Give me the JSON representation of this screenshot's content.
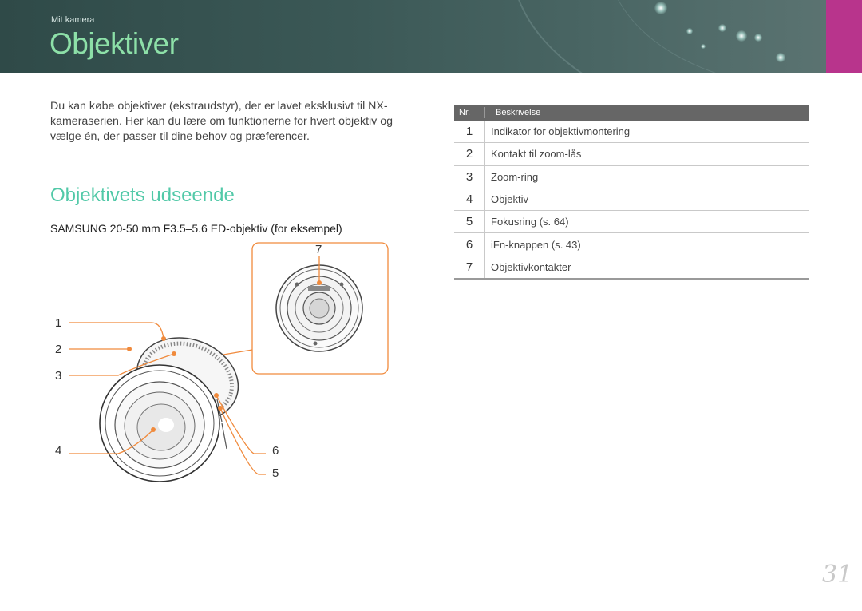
{
  "header": {
    "breadcrumb": "Mit kamera",
    "title": "Objektiver"
  },
  "intro": "Du kan købe objektiver (ekstraudstyr), der er lavet eksklusivt til NX-kameraserien. Her kan du lære om funktionerne for hvert objektiv og vælge én, der passer til dine behov og præferencer.",
  "section_title": "Objektivets udseende",
  "lens_caption": "SAMSUNG 20-50 mm F3.5–5.6 ED-objektiv (for eksempel)",
  "callouts": {
    "n1": "1",
    "n2": "2",
    "n3": "3",
    "n4": "4",
    "n5": "5",
    "n6": "6",
    "n7": "7"
  },
  "table": {
    "col_nr": "Nr.",
    "col_desc": "Beskrivelse",
    "rows": [
      {
        "nr": "1",
        "desc": "Indikator for objektivmontering"
      },
      {
        "nr": "2",
        "desc": "Kontakt til zoom-lås"
      },
      {
        "nr": "3",
        "desc": "Zoom-ring"
      },
      {
        "nr": "4",
        "desc": "Objektiv"
      },
      {
        "nr": "5",
        "desc": "Fokusring (s. 64)"
      },
      {
        "nr": "6",
        "desc": "iFn-knappen (s. 43)"
      },
      {
        "nr": "7",
        "desc": "Objektivkontakter"
      }
    ]
  },
  "page_number": "31",
  "colors": {
    "accent_green": "#8de0a8",
    "section_green": "#52c9a8",
    "callout_orange": "#f08a3c",
    "header_pink": "#b8348c"
  }
}
